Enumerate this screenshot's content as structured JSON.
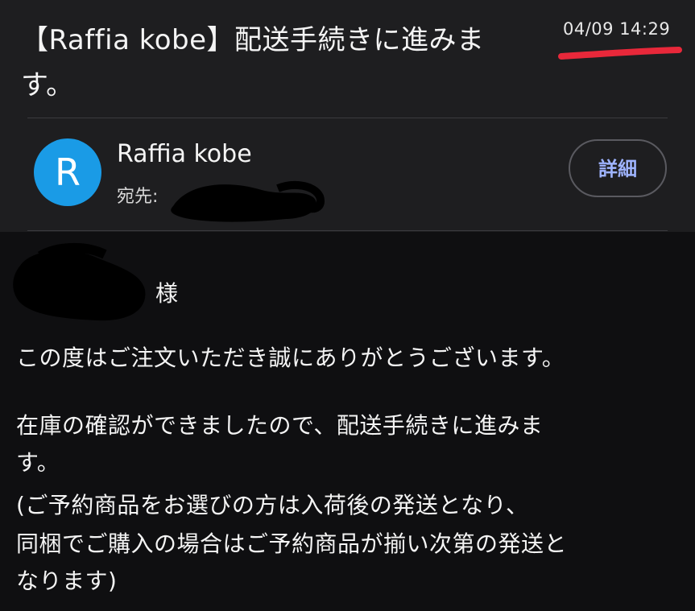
{
  "email": {
    "subject": "【Raffia kobe】配送手続きに進みます。",
    "date": "04/09 14:29",
    "sender": {
      "avatar_letter": "R",
      "name": "Raffia kobe",
      "recipient_label": "宛先:"
    },
    "details_button": "詳細"
  },
  "body": {
    "salutation_suffix": "様",
    "line1": "この度はご注文いただき誠にありがとうございます。",
    "para2_line1": "在庫の確認ができましたので、配送手続きに進みま",
    "para2_line2": "す。",
    "para2_line3": "(ご予約商品をお選びの方は入荷後の発送となり、",
    "para2_line4": "同梱でご購入の場合はご予約商品が揃い次第の発送と",
    "para2_line5": "なります)"
  },
  "colors": {
    "header_bg": "#1e1e20",
    "page_bg": "#0f0f11",
    "avatar": "#1a9be6",
    "accent_text": "#9fb4ff",
    "annotation_red": "#e8283a"
  }
}
